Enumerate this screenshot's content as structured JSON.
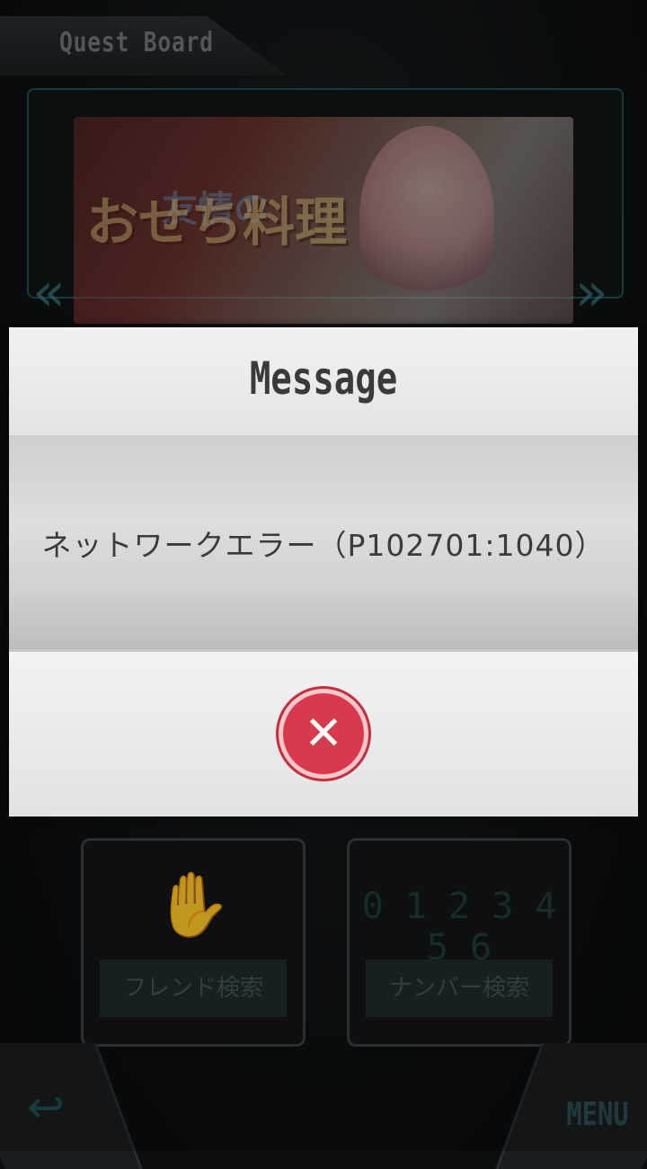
{
  "header": {
    "title": "Quest Board"
  },
  "banner": {
    "title": "おせち料理",
    "sub": "友情の"
  },
  "tiles": [
    {
      "label": "フレンド検索",
      "icon": "handshake-icon"
    },
    {
      "label": "ナンバー検索",
      "icon": "number-icon",
      "digits": "0 1 2 3 4 5 6"
    }
  ],
  "footer": {
    "menu_label": "MENU",
    "back_icon": "back-arrow-icon"
  },
  "dialog": {
    "title": "Message",
    "message": "ネットワークエラー（P102701:1040）",
    "close_icon": "close-icon"
  },
  "colors": {
    "accent": "#d63a4c",
    "frame": "#1f4e57"
  }
}
